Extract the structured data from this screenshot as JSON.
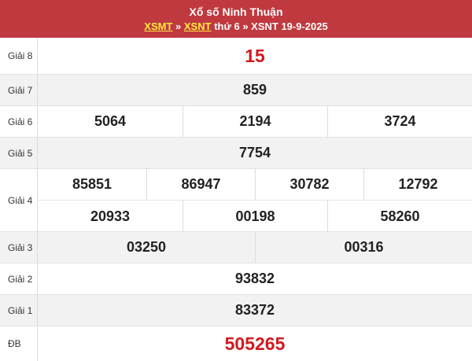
{
  "header": {
    "title": "Xổ số Ninh Thuận",
    "link1": "XSMT",
    "sep1": "»",
    "link2": "XSNT",
    "rest": "thứ 6 » XSNT 19-9-2025"
  },
  "rows": {
    "g8": {
      "label": "Giải 8",
      "numbers": [
        "15"
      ]
    },
    "g7": {
      "label": "Giải 7",
      "numbers": [
        "859"
      ]
    },
    "g6": {
      "label": "Giải 6",
      "numbers": [
        "5064",
        "2194",
        "3724"
      ]
    },
    "g5": {
      "label": "Giải 5",
      "numbers": [
        "7754"
      ]
    },
    "g4": {
      "label": "Giải 4",
      "numbers": [
        "85851",
        "86947",
        "30782",
        "12792",
        "20933",
        "00198",
        "58260"
      ]
    },
    "g3": {
      "label": "Giải 3",
      "numbers": [
        "03250",
        "00316"
      ]
    },
    "g2": {
      "label": "Giải 2",
      "numbers": [
        "93832"
      ]
    },
    "g1": {
      "label": "Giải 1",
      "numbers": [
        "83372"
      ]
    },
    "db": {
      "label": "ĐB",
      "numbers": [
        "505265"
      ]
    }
  },
  "colors": {
    "header_bg": "#c0393f",
    "link": "#ffec3d",
    "highlight": "#d0191f",
    "alt_row": "#f2f2f2"
  }
}
